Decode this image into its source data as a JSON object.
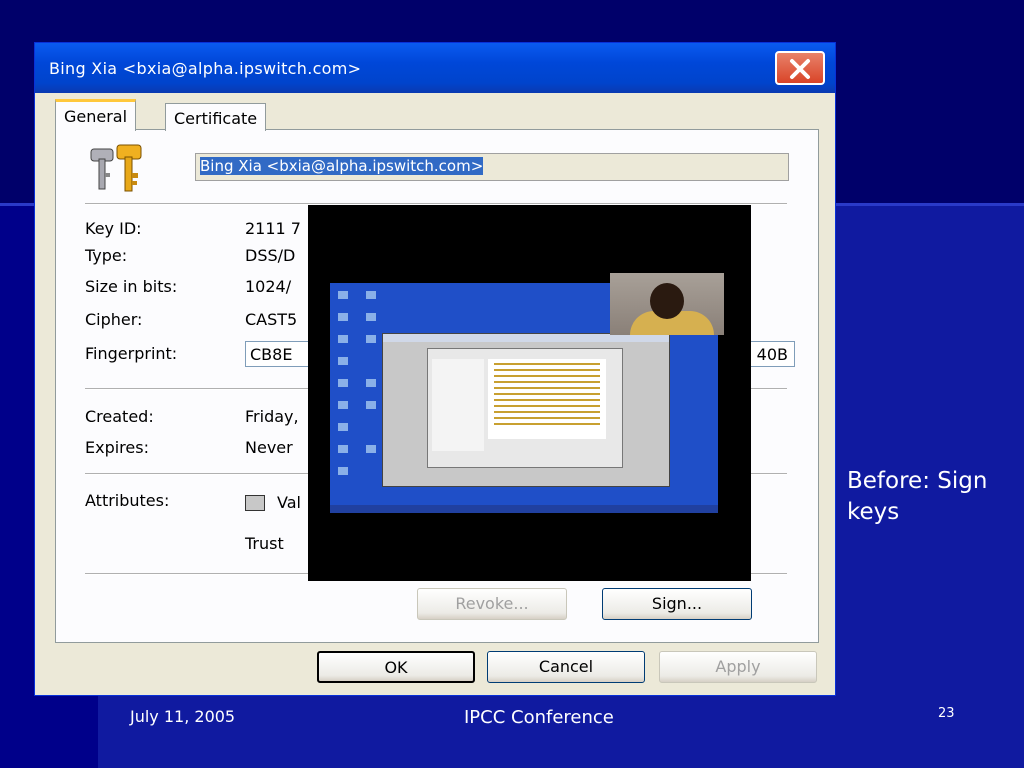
{
  "dialog": {
    "title": "Bing Xia <bxia@alpha.ipswitch.com>",
    "tabs": [
      {
        "label": "General"
      },
      {
        "label": "Certificate"
      }
    ],
    "name_field": "Bing Xia <bxia@alpha.ipswitch.com>",
    "fields": {
      "key_id_label": "Key ID:",
      "key_id_value": "2111 7",
      "type_label": "Type:",
      "type_value": "DSS/D",
      "size_label": "Size in bits:",
      "size_value": "1024/",
      "cipher_label": "Cipher:",
      "cipher_value": "CAST5",
      "fingerprint_label": "Fingerprint:",
      "fingerprint_start": "CB8E",
      "fingerprint_end": "40B",
      "created_label": "Created:",
      "created_value": "Friday,",
      "expires_label": "Expires:",
      "expires_value": "Never",
      "attributes_label": "Attributes:",
      "valid_label": "Val",
      "trust_label": "Trust"
    },
    "buttons": {
      "revoke": "Revoke...",
      "sign": "Sign...",
      "ok": "OK",
      "cancel": "Cancel",
      "apply": "Apply"
    },
    "icons": {
      "keys": "keys-icon",
      "close": "close-icon"
    }
  },
  "slide": {
    "note_line1": "Before: Sign",
    "note_line2": "keys",
    "footer_date": "July 11, 2005",
    "footer_title": "IPCC Conference",
    "page_number": "23"
  },
  "colors": {
    "slide_background": "#00006a",
    "titlebar": "#0047d8",
    "dialog_face": "#ece9d8",
    "close_button": "#d94428"
  }
}
